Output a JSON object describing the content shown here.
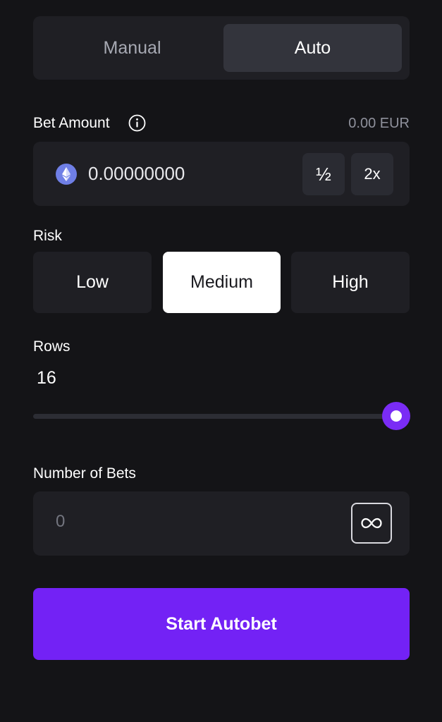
{
  "mode": {
    "manual_label": "Manual",
    "auto_label": "Auto",
    "selected": "Auto"
  },
  "bet_amount": {
    "label": "Bet Amount",
    "fiat_value": "0.00 EUR",
    "value": "0.00000000",
    "currency_icon": "ethereum-icon",
    "half_label": "½",
    "double_label": "2x"
  },
  "risk": {
    "label": "Risk",
    "options": [
      "Low",
      "Medium",
      "High"
    ],
    "selected": "Medium"
  },
  "rows": {
    "label": "Rows",
    "value": "16",
    "min": 8,
    "max": 16,
    "current": 16
  },
  "number_of_bets": {
    "label": "Number of Bets",
    "placeholder": "0",
    "infinity_icon": "infinity-icon"
  },
  "start_button": {
    "label": "Start Autobet"
  },
  "colors": {
    "background": "#141417",
    "surface": "#1f1f24",
    "accent": "#7322f5",
    "selected_risk": "#ffffff"
  }
}
